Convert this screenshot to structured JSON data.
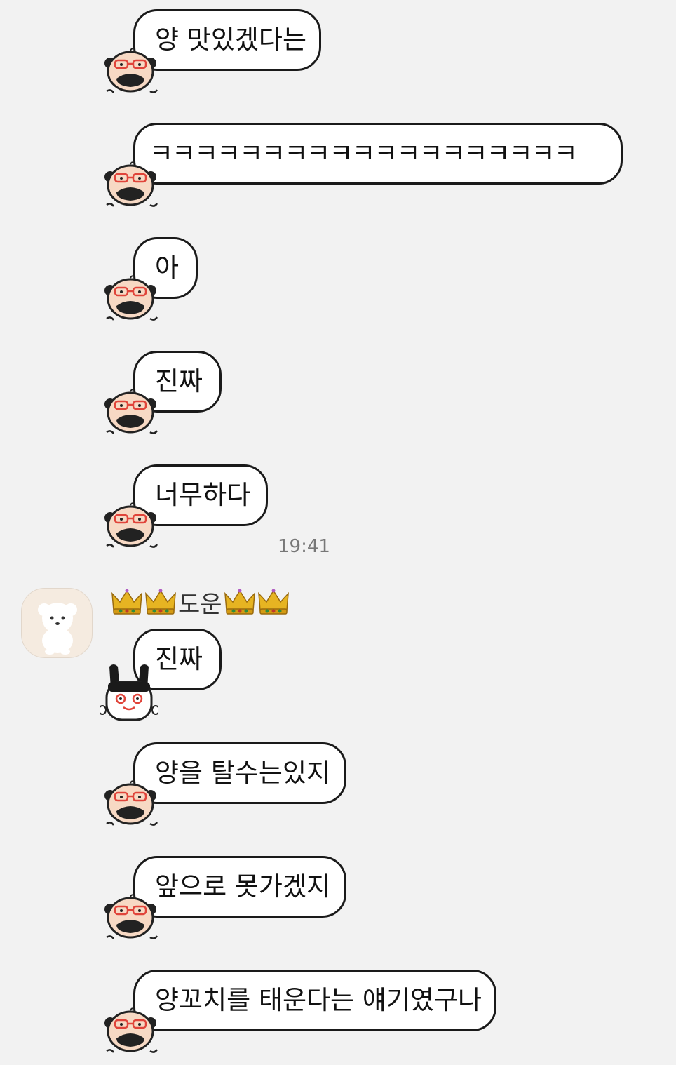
{
  "messages": [
    {
      "text": "양 맛있겠다는"
    },
    {
      "text": "ㅋㅋㅋㅋㅋㅋㅋㅋㅋㅋㅋㅋㅋㅋㅋㅋㅋㅋㅋ"
    },
    {
      "text": "아"
    },
    {
      "text": "진짜"
    },
    {
      "text": "너무하다"
    },
    {
      "text": "진짜"
    },
    {
      "text": "양을 탈수는있지"
    },
    {
      "text": "앞으로 못가겠지"
    },
    {
      "text": "양꼬치를 태운다는 얘기였구나"
    }
  ],
  "timestamp": "19:41",
  "sender": {
    "name": "도운",
    "decoration_icon": "crown-icon"
  },
  "colors": {
    "background": "#f2f2f2",
    "bubble": "#ffffff",
    "bubble_border": "#1a1a1a"
  }
}
